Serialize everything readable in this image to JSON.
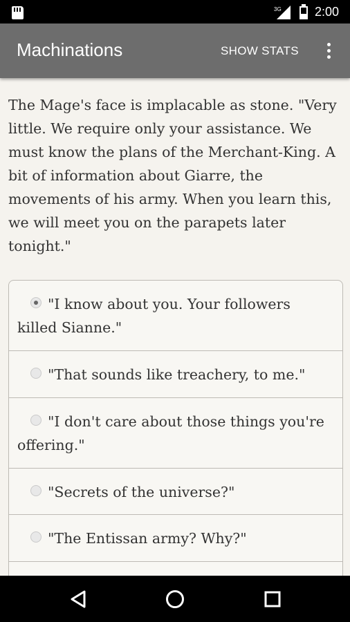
{
  "status_bar": {
    "time": "2:00",
    "network_label": "3G",
    "icons": [
      "sd-card-icon",
      "signal-icon",
      "battery-icon"
    ]
  },
  "app_bar": {
    "title": "Machinations",
    "show_stats_label": "SHOW STATS",
    "overflow_icon": "overflow-menu-icon"
  },
  "story": {
    "text": "The Mage's face is implacable as stone. \"Very little. We require only your assistance. We must know the plans of the Merchant-King. A bit of information about Giarre, the movements of his army. When you learn this, we will meet you on the parapets later tonight.\""
  },
  "choices": [
    {
      "label": "\"I know about you. Your followers killed Sianne.\"",
      "selected": true
    },
    {
      "label": "\"That sounds like treachery, to me.\"",
      "selected": false
    },
    {
      "label": "\"I don't care about those things you're offering.\"",
      "selected": false
    },
    {
      "label": "\"Secrets of the universe?\"",
      "selected": false
    },
    {
      "label": "\"The Entissan army? Why?\"",
      "selected": false
    }
  ],
  "nav_bar": {
    "icons": [
      "back-icon",
      "home-icon",
      "recents-icon"
    ]
  }
}
